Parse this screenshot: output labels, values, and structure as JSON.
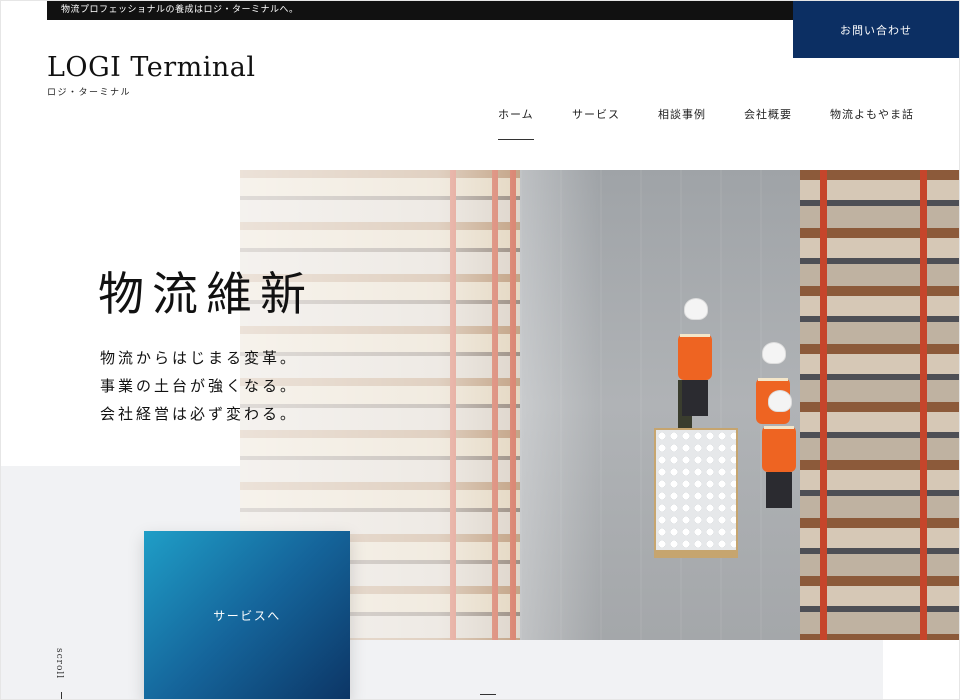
{
  "header": {
    "tagline": "物流プロフェッショナルの養成はロジ・ターミナルへ。",
    "contact_label": "お問い合わせ",
    "logo_main": "LOGI Terminal",
    "logo_sub": "ロジ・ターミナル"
  },
  "nav": {
    "items": [
      {
        "label": "ホーム",
        "active": true
      },
      {
        "label": "サービス"
      },
      {
        "label": "相談事例"
      },
      {
        "label": "会社概要"
      },
      {
        "label": "物流よもやま話"
      }
    ]
  },
  "hero": {
    "title": "物流維新",
    "lines": [
      "物流からはじまる変革。",
      "事業の土台が強くなる。",
      "会社経営は必ず変わる。"
    ]
  },
  "service_card": {
    "label": "サービスへ"
  },
  "scroll": {
    "label": "scroll"
  },
  "colors": {
    "accent_navy": "#0c2f63",
    "card_gradient_start": "#1f9ec7",
    "card_gradient_end": "#0c3565",
    "vest_orange": "#ee6422"
  }
}
